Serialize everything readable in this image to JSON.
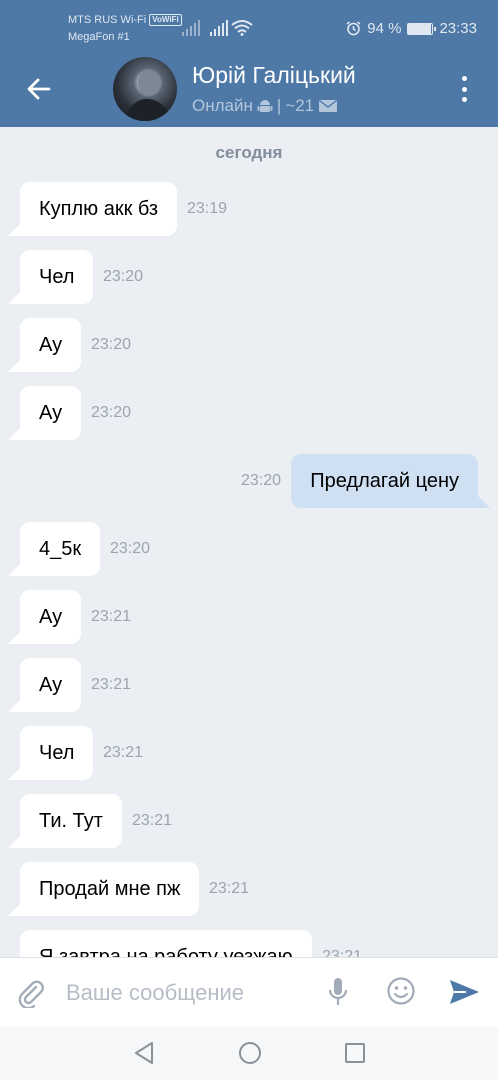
{
  "status_bar": {
    "carrier_1": "MTS RUS Wi-Fi",
    "volte_badge": "VoWiFi",
    "carrier_2": "MegaFon #1",
    "battery": "94 %",
    "battery_level": 0.94,
    "time": "23:33"
  },
  "header": {
    "name": "Юрій Галіцький",
    "status": "Онлайн",
    "separator": "|",
    "unread": "~21"
  },
  "chat": {
    "date_label": "сегодня",
    "messages": [
      {
        "dir": "in",
        "text": "Куплю акк бз",
        "time": "23:19"
      },
      {
        "dir": "in",
        "text": "Чел",
        "time": "23:20"
      },
      {
        "dir": "in",
        "text": "Ау",
        "time": "23:20"
      },
      {
        "dir": "in",
        "text": "Ау",
        "time": "23:20"
      },
      {
        "dir": "out",
        "text": "Предлагай цену",
        "time": "23:20"
      },
      {
        "dir": "in",
        "text": "4_5к",
        "time": "23:20"
      },
      {
        "dir": "in",
        "text": "Ау",
        "time": "23:21"
      },
      {
        "dir": "in",
        "text": "Ау",
        "time": "23:21"
      },
      {
        "dir": "in",
        "text": "Чел",
        "time": "23:21"
      },
      {
        "dir": "in",
        "text": "Ти. Тут",
        "time": "23:21"
      },
      {
        "dir": "in",
        "text": "Продай мне пж",
        "time": "23:21"
      },
      {
        "dir": "in",
        "text": "Я завтра на работу уезжаю",
        "time": "23:21"
      }
    ]
  },
  "composer": {
    "placeholder": "Ваше сообщение"
  },
  "colors": {
    "header": "#4e78a6",
    "background": "#ebeef3",
    "outgoing_bubble": "#cfe0f3",
    "incoming_bubble": "#ffffff",
    "send_icon": "#4e78a6"
  },
  "icons": [
    "back-arrow-icon",
    "android-icon",
    "mail-icon",
    "more-vert-icon",
    "attach-icon",
    "mic-icon",
    "emoji-icon",
    "send-icon",
    "nav-back-icon",
    "nav-home-icon",
    "nav-recent-icon"
  ]
}
